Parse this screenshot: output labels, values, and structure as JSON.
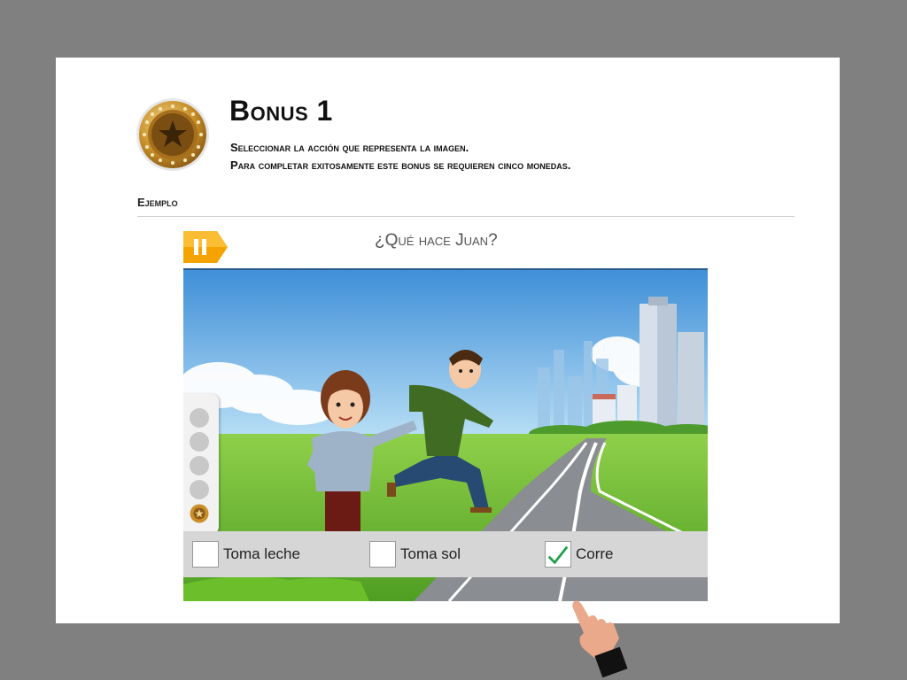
{
  "header": {
    "title": "Bonus 1",
    "instruction_line1": "Seleccionar la acción que representa la imagen.",
    "instruction_line2": "Para completar exitosamente este bonus se requieren cinco monedas."
  },
  "section": {
    "example_label": "Ejemplo"
  },
  "activity": {
    "pause_label": "II",
    "question": "¿Qué hace Juan?",
    "options": [
      {
        "label": "Toma leche",
        "checked": false
      },
      {
        "label": "Toma sol",
        "checked": false
      },
      {
        "label": "Corre",
        "checked": true
      }
    ],
    "progress": {
      "coins_total": 5,
      "coins_earned": 1
    }
  },
  "colors": {
    "background": "#808080",
    "pause_tab": "#f5a300",
    "check": "#22a04a",
    "coin_gold": "#c9902a"
  },
  "icons": [
    "coin-star-icon",
    "pause-icon",
    "check-icon",
    "pointing-hand-icon"
  ]
}
